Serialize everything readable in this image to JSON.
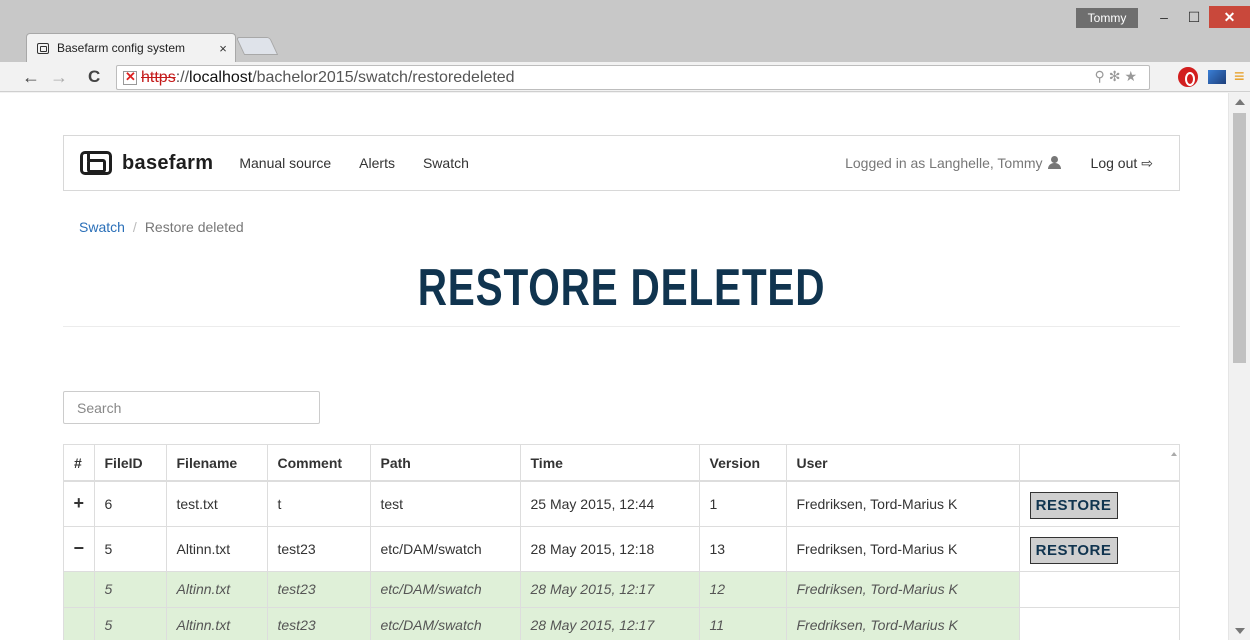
{
  "browser": {
    "tab_title": "Basefarm config system",
    "tab_close": "×",
    "user_badge": "Tommy",
    "url_proto": "https",
    "url_host_prefix": "://",
    "url_host": "localhost",
    "url_path": "/bachelor2015/swatch/restoredeleted",
    "window_min": "–",
    "window_max": "☐",
    "window_close": "✕"
  },
  "navbar": {
    "brand": "basefarm",
    "links": [
      "Manual source",
      "Alerts",
      "Swatch"
    ],
    "logged_in": "Logged in as Langhelle, Tommy",
    "logout": "Log out"
  },
  "breadcrumb": {
    "parent": "Swatch",
    "separator": "/",
    "current": "Restore deleted"
  },
  "page": {
    "title": "RESTORE DELETED",
    "search_placeholder": "Search"
  },
  "table": {
    "headers": [
      "#",
      "FileID",
      "Filename",
      "Comment",
      "Path",
      "Time",
      "Version",
      "User",
      ""
    ],
    "restore_label": "RESTORE",
    "rows": [
      {
        "toggle": "+",
        "fileid": "6",
        "filename": "test.txt",
        "comment": "t",
        "path": "test",
        "time": "25 May 2015, 12:44",
        "version": "1",
        "user": "Fredriksen, Tord-Marius K"
      },
      {
        "toggle": "−",
        "fileid": "5",
        "filename": "Altinn.txt",
        "comment": "test23",
        "path": "etc/DAM/swatch",
        "time": "28 May 2015, 12:18",
        "version": "13",
        "user": "Fredriksen, Tord-Marius K"
      }
    ],
    "subrows": [
      {
        "fileid": "5",
        "filename": "Altinn.txt",
        "comment": "test23",
        "path": "etc/DAM/swatch",
        "time": "28 May 2015, 12:17",
        "version": "12",
        "user": "Fredriksen, Tord-Marius K"
      },
      {
        "fileid": "5",
        "filename": "Altinn.txt",
        "comment": "test23",
        "path": "etc/DAM/swatch",
        "time": "28 May 2015, 12:17",
        "version": "11",
        "user": "Fredriksen, Tord-Marius K"
      }
    ]
  },
  "colors": {
    "title": "#10344f",
    "link": "#2a6fb8",
    "subrow_bg": "#dff0d8",
    "close_btn": "#c9483b"
  }
}
